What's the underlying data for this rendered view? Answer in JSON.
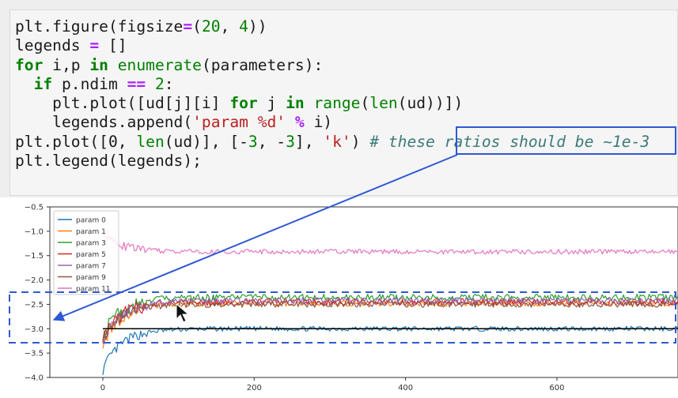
{
  "code": {
    "lines": [
      [
        {
          "t": "plt.figure(figsize"
        },
        {
          "t": "=",
          "c": "op"
        },
        {
          "t": "("
        },
        {
          "t": "20",
          "c": "num"
        },
        {
          "t": ", "
        },
        {
          "t": "4",
          "c": "num"
        },
        {
          "t": "))"
        }
      ],
      [
        {
          "t": "legends "
        },
        {
          "t": "=",
          "c": "op"
        },
        {
          "t": " []"
        }
      ],
      [
        {
          "t": "for",
          "c": "kw"
        },
        {
          "t": " i,p "
        },
        {
          "t": "in",
          "c": "kw"
        },
        {
          "t": " "
        },
        {
          "t": "enumerate",
          "c": "num"
        },
        {
          "t": "(parameters):"
        }
      ],
      [
        {
          "t": "  "
        },
        {
          "t": "if",
          "c": "kw"
        },
        {
          "t": " p.ndim "
        },
        {
          "t": "==",
          "c": "op"
        },
        {
          "t": " "
        },
        {
          "t": "2",
          "c": "num"
        },
        {
          "t": ":"
        }
      ],
      [
        {
          "t": "    plt.plot([ud[j][i] "
        },
        {
          "t": "for",
          "c": "kw"
        },
        {
          "t": " j "
        },
        {
          "t": "in",
          "c": "kw"
        },
        {
          "t": " "
        },
        {
          "t": "range",
          "c": "num"
        },
        {
          "t": "("
        },
        {
          "t": "len",
          "c": "num"
        },
        {
          "t": "(ud))])"
        }
      ],
      [
        {
          "t": "    legends.append("
        },
        {
          "t": "'param %d'",
          "c": "str"
        },
        {
          "t": " "
        },
        {
          "t": "%",
          "c": "op"
        },
        {
          "t": " i)"
        }
      ],
      [
        {
          "t": "plt.plot([0, "
        },
        {
          "t": "len",
          "c": "num"
        },
        {
          "t": "(ud)], [-"
        },
        {
          "t": "3",
          "c": "num"
        },
        {
          "t": ", -"
        },
        {
          "t": "3",
          "c": "num"
        },
        {
          "t": "], "
        },
        {
          "t": "'k'",
          "c": "str"
        },
        {
          "t": ") "
        },
        {
          "t": "# these ratios should be ~1e-3",
          "c": "cmt"
        }
      ],
      [
        {
          "t": "plt.legend(legends);"
        }
      ]
    ]
  },
  "chart_data": {
    "type": "line",
    "xlim": [
      -70,
      760
    ],
    "ylim": [
      -4.0,
      -0.5
    ],
    "x_ticks": [
      0,
      200,
      400,
      600
    ],
    "y_ticks": [
      -0.5,
      -1.0,
      -1.5,
      -2.0,
      -2.5,
      -3.0,
      -3.5,
      -4.0
    ],
    "y_tick_labels": [
      "−0.5",
      "−1.0",
      "−1.5",
      "−2.0",
      "−2.5",
      "−3.0",
      "−3.5",
      "−4.0"
    ],
    "reference_line": {
      "x": [
        0,
        760
      ],
      "y": [
        -3,
        -3
      ],
      "color": "#000000"
    },
    "legend_position": "upper-left",
    "series": [
      {
        "name": "param 0",
        "color": "#1f77b4",
        "start": -3.85,
        "level": -3.0,
        "noise": 0.05
      },
      {
        "name": "param 1",
        "color": "#ff7f0e",
        "start": -3.3,
        "level": -2.48,
        "noise": 0.06
      },
      {
        "name": "param 3",
        "color": "#2ca02c",
        "start": -3.1,
        "level": -2.36,
        "noise": 0.07
      },
      {
        "name": "param 5",
        "color": "#d62728",
        "start": -3.2,
        "level": -2.45,
        "noise": 0.07
      },
      {
        "name": "param 7",
        "color": "#9467bd",
        "start": -3.25,
        "level": -2.42,
        "noise": 0.06
      },
      {
        "name": "param 9",
        "color": "#8c564b",
        "start": -3.2,
        "level": -2.5,
        "noise": 0.06
      },
      {
        "name": "param 11",
        "color": "#e377c2",
        "start": -1.05,
        "level": -1.42,
        "noise": 0.05
      }
    ]
  },
  "annotation": {
    "color": "#2f58d6"
  }
}
